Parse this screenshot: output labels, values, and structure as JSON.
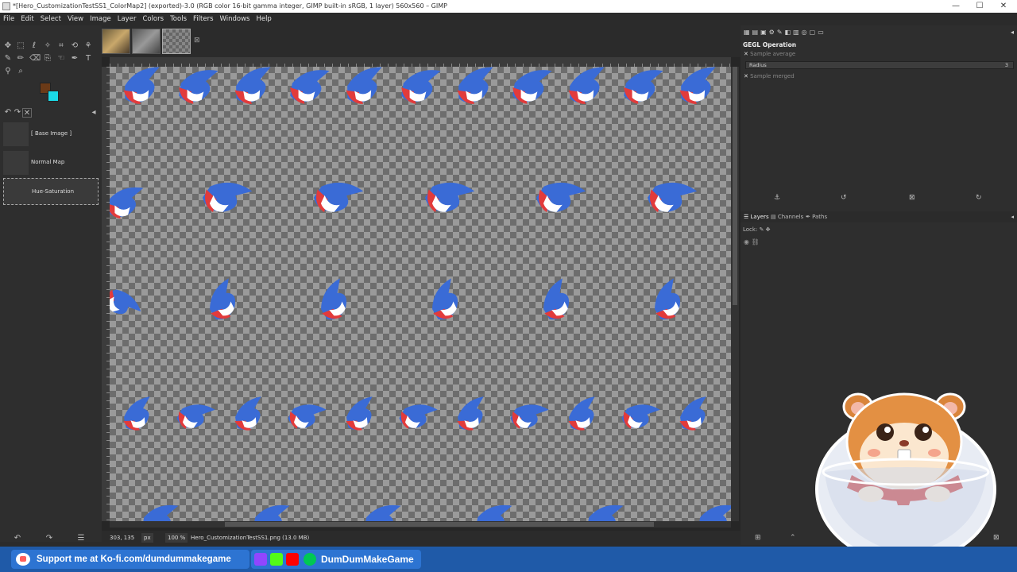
{
  "window": {
    "title": "*[Hero_CustomizationTestSS1_ColorMap2] (exported)-3.0 (RGB color 16-bit gamma integer, GIMP built-in sRGB, 1 layer) 560x560 – GIMP",
    "min": "—",
    "max": "☐",
    "close": "✕"
  },
  "menu": [
    "File",
    "Edit",
    "Select",
    "View",
    "Image",
    "Layer",
    "Colors",
    "Tools",
    "Filters",
    "Windows",
    "Help"
  ],
  "image_tabs": {
    "close": "⊠"
  },
  "layers_left": [
    {
      "name": "[ Base Image ]"
    },
    {
      "name": "Normal Map"
    },
    {
      "name": "Hue-Saturation"
    }
  ],
  "status": {
    "coords": "303, 135",
    "unit": "px",
    "zoom": "100 %",
    "file": "Hero_CustomizationTestSS1.png (13.0 MB)"
  },
  "gegl": {
    "title": "GEGL Operation",
    "sample_average": "Sample average",
    "radius_label": "Radius",
    "radius_value": "3",
    "sample_merged": "Sample merged"
  },
  "dock_tabs": {
    "layers": "Layers",
    "channels": "Channels",
    "paths": "Paths",
    "lock": "Lock:"
  },
  "colors": {
    "fg": "#6b3a17",
    "bg": "#1ad9e6",
    "accent_blue": "#1f5aa8"
  },
  "banner": {
    "kofi": "Support me at Ko-fi.com/dumdummakegame",
    "channel": "DumDumMakeGame"
  }
}
